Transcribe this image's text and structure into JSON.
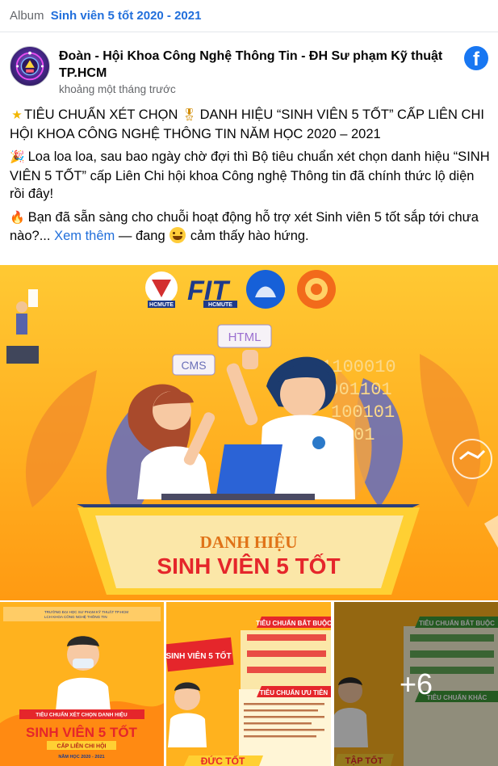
{
  "album": {
    "prefix": "Album",
    "title": "Sinh viên 5 tốt 2020 - 2021"
  },
  "post": {
    "page_name": "Đoàn - Hội Khoa Công Nghệ Thông Tin - ĐH Sư phạm Kỹ thuật TP.HCM",
    "timestamp": "khoảng một tháng trước",
    "source_icon": "facebook-icon",
    "fb_glyph": "f",
    "paragraphs": {
      "p1": "TIÊU CHUẨN XÉT CHỌN",
      "p1b": "DANH HIỆU “SINH VIÊN 5 TỐT” CẤP LIÊN CHI HỘI KHOA CÔNG NGHỆ THÔNG TIN NĂM HỌC 2020 – 2021",
      "p2": "Loa loa loa, sau bao ngày chờ đợi thì Bộ tiêu chuẩn xét chọn danh hiệu “SINH VIÊN 5 TỐT” cấp Liên Chi hội khoa Công nghệ Thông tin đã chính thức lộ diện rồi đây!",
      "p3": "Bạn đã sẵn sàng cho chuỗi hoạt động hỗ trợ xét Sinh viên 5 tốt sắp tới chưa nào?...",
      "see_more": "Xem thêm",
      "feeling_prefix": "— đang",
      "feeling": "cảm thấy hào hứng."
    },
    "emojis": {
      "star": "★",
      "medal": "🎖",
      "party": "🎉",
      "fire": "🔥"
    }
  },
  "main_image": {
    "logos": [
      "HCMUTE",
      "FIT",
      "HCMUTE"
    ],
    "tags": [
      "HTML",
      "CMS"
    ],
    "binary_lines": [
      "01100010",
      "10001101",
      "100101",
      "0001101"
    ],
    "banner_line1": "DANH HIỆU",
    "banner_line2": "SINH VIÊN 5 TỐT",
    "colors": {
      "background": "#ffb92b",
      "banner": "#f7b21e",
      "text_red": "#e5262b"
    }
  },
  "thumbnails": [
    {
      "header": "TRƯỜNG ĐẠI HỌC SƯ PHẠM KỸ THUẬT TP.HCM",
      "subheader": "LCH KHOA CÔNG NGHỆ THÔNG TIN",
      "ribbon": "TIÊU CHUẨN XÉT CHỌN DANH HIỆU",
      "title": "SINH VIÊN 5 TỐT",
      "sub": "CẤP LIÊN CHI HỘI",
      "year": "NĂM HỌC 2020 - 2021"
    },
    {
      "title_top": "TIÊU CHUẨN BẮT BUỘC",
      "title_mid": "TIÊU CHUẨN ƯU TIÊN",
      "side": "SINH VIÊN 5 TỐT",
      "bottom": "ĐỨC TỐT"
    },
    {
      "title_top": "TIÊU CHUẨN BẮT BUỘC",
      "title_mid": "TIÊU CHUẨN KHÁC",
      "bottom": "TẬP TỐT",
      "more": "+6"
    }
  ]
}
